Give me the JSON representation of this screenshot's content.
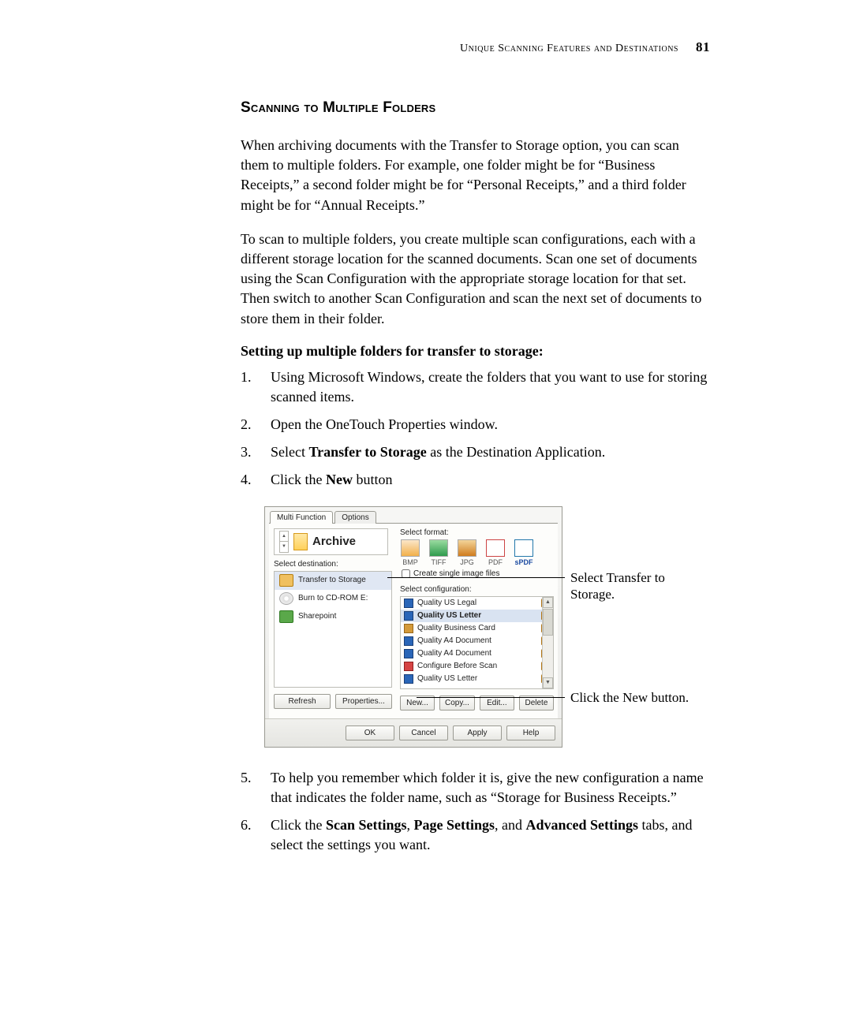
{
  "header": {
    "running": "Unique Scanning Features and Destinations",
    "page_number": "81"
  },
  "section_title": "Scanning to Multiple Folders",
  "para1": "When archiving documents with the Transfer to Storage option, you can scan them to multiple folders. For example, one folder might be for “Business Receipts,” a second folder might be for “Personal Receipts,” and a third folder might be for “Annual Receipts.”",
  "para2": "To scan to multiple folders, you create multiple scan configurations, each with a different storage location for the scanned documents. Scan one set of documents using the Scan Configuration with the appropriate storage location for that set. Then switch to another Scan Configuration and scan the next set of documents to store them in their folder.",
  "subhead": "Setting up multiple folders for transfer to storage:",
  "steps_a": [
    "Using Microsoft Windows, create the folders that you want to use for storing scanned items.",
    "Open the OneTouch Properties window."
  ],
  "step3_pre": "Select ",
  "step3_bold": "Transfer to Storage",
  "step3_post": " as the Destination Application.",
  "step4_pre": "Click the ",
  "step4_bold": "New",
  "step4_post": " button",
  "steps_b": {
    "step5": "To help you remember which folder it is, give the new configuration a name that indicates the folder name, such as “Storage for Business Receipts.”",
    "step6_pre": "Click the ",
    "step6_b1": "Scan Settings",
    "step6_s1": ", ",
    "step6_b2": "Page Settings",
    "step6_s2": ", and ",
    "step6_b3": "Advanced Settings",
    "step6_post": " tabs, and select the settings you want."
  },
  "dialog": {
    "tabs": [
      "Multi Function",
      "Options"
    ],
    "archive_label": "Archive",
    "select_destination": "Select destination:",
    "select_format": "Select format:",
    "destinations": [
      {
        "name": "Transfer to Storage",
        "selected": true,
        "icon": "folder"
      },
      {
        "name": "Burn to CD-ROM  E:",
        "selected": false,
        "icon": "cd"
      },
      {
        "name": "Sharepoint",
        "selected": false,
        "icon": "sp"
      }
    ],
    "formats": [
      {
        "code": "BMP"
      },
      {
        "code": "TIFF"
      },
      {
        "code": "JPG"
      },
      {
        "code": "PDF"
      },
      {
        "code": "sPDF",
        "selected": true
      }
    ],
    "create_single": "Create single image files",
    "select_config": "Select configuration:",
    "configs": [
      {
        "name": "Quality US Legal",
        "icon": "std"
      },
      {
        "name": "Quality US Letter",
        "icon": "std",
        "selected": true
      },
      {
        "name": "Quality Business Card",
        "icon": "card"
      },
      {
        "name": "Quality A4 Document",
        "icon": "std"
      },
      {
        "name": "Quality A4 Document",
        "icon": "std"
      },
      {
        "name": "Configure Before Scan",
        "icon": "conf"
      },
      {
        "name": "Quality US Letter",
        "icon": "std"
      }
    ],
    "buttons_left": [
      "Refresh",
      "Properties..."
    ],
    "buttons_right": [
      "New...",
      "Copy...",
      "Edit...",
      "Delete"
    ],
    "bottom": [
      "OK",
      "Cancel",
      "Apply",
      "Help"
    ]
  },
  "callouts": {
    "c1": "Select Transfer to Storage.",
    "c2": "Click the New button."
  }
}
